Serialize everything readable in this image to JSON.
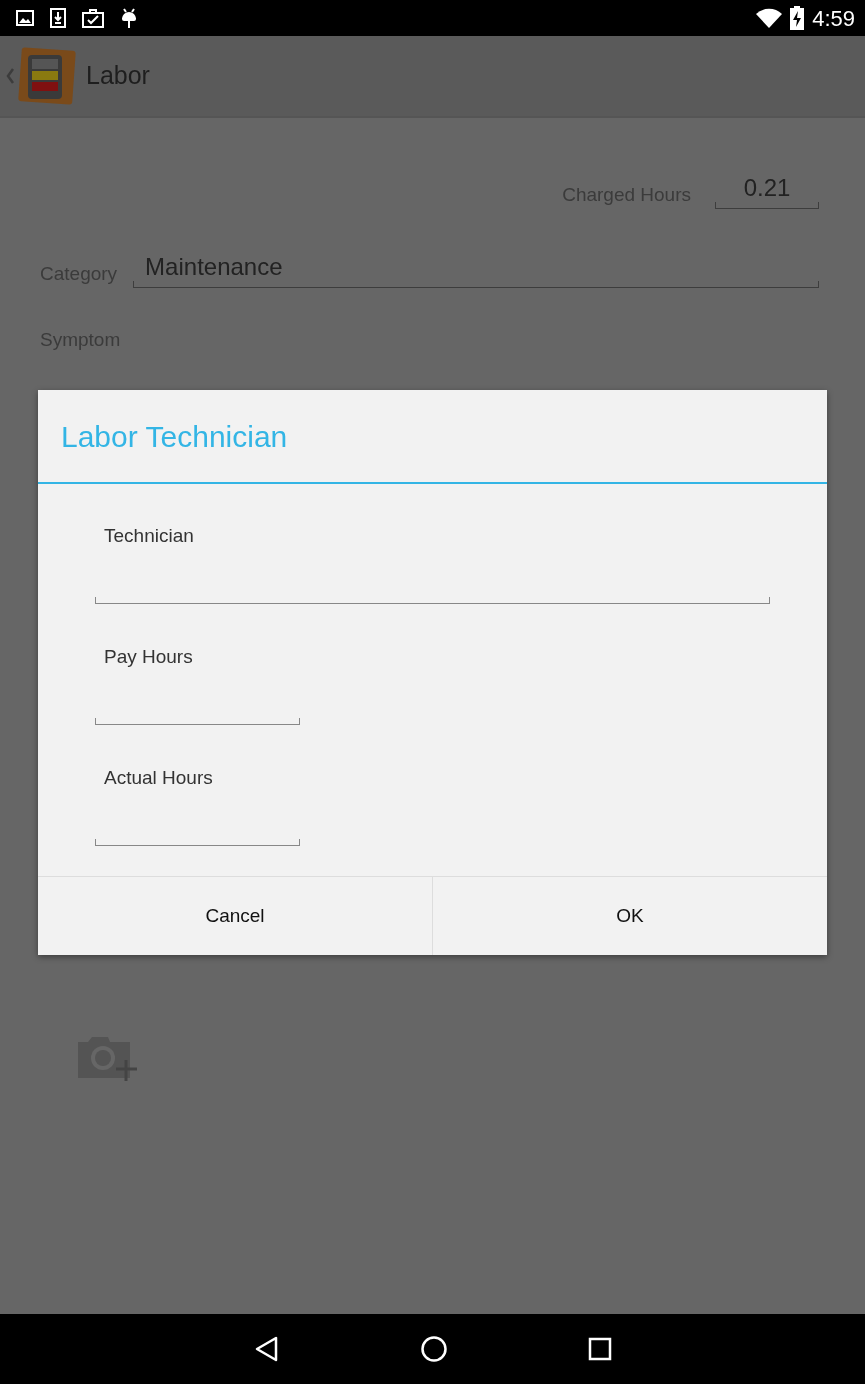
{
  "status_bar": {
    "time": "4:59"
  },
  "app_bar": {
    "title": "Labor"
  },
  "form": {
    "charged_hours": {
      "label": "Charged Hours",
      "value": "0.21"
    },
    "category": {
      "label": "Category",
      "value": "Maintenance"
    },
    "symptom": {
      "label": "Symptom"
    }
  },
  "dialog": {
    "title": "Labor Technician",
    "fields": [
      {
        "label": "Technician",
        "kind": "text"
      },
      {
        "label": "Pay Hours",
        "kind": "number"
      },
      {
        "label": "Actual Hours",
        "kind": "number"
      }
    ],
    "buttons": [
      "Cancel",
      "OK"
    ]
  }
}
